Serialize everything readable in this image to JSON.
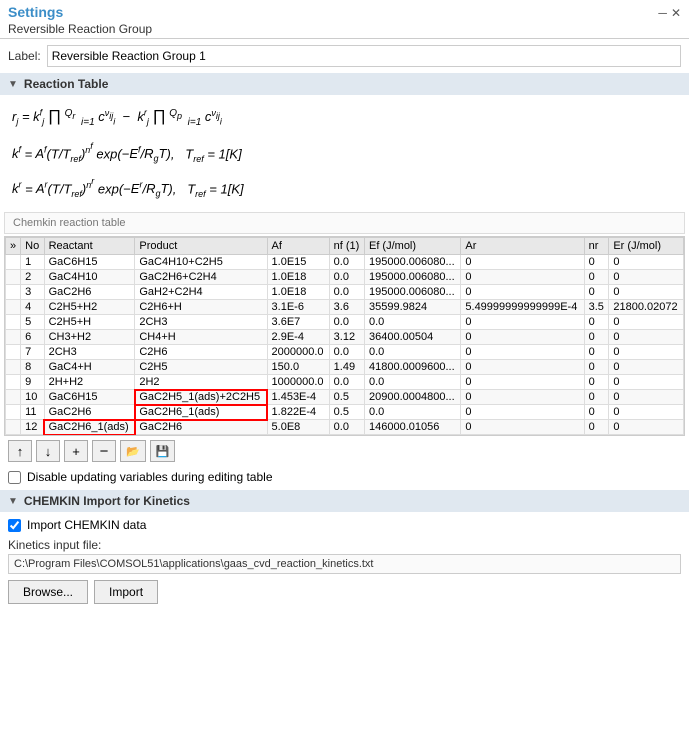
{
  "header": {
    "title": "Settings",
    "subtitle": "Reversible Reaction Group",
    "minimize_icon": "─",
    "close_icon": "✕"
  },
  "label_row": {
    "label": "Label:",
    "value": "Reversible Reaction Group 1"
  },
  "reaction_table_section": {
    "title": "Reaction Table",
    "formula1": "rⱼ = kʲ_f ∏ cᵢ^νᵢⱼ i=1..Qr  − kʲ_r ∏ cᵢ^νᵢⱼ i=1..Qp",
    "formula2": "kᶠ = Aᶠ(T/T_ref)^nf exp(−Eᶠ/RgT),  T_ref = 1[K]",
    "formula3": "kʳ = Aʳ(T/T_ref)^nr exp(−Eʳ/RgT),  T_ref = 1[K]",
    "chemkin_label": "Chemkin reaction table",
    "columns": [
      "",
      "No",
      "Reactant",
      "Product",
      "Af",
      "nf (1)",
      "Ef (J/mol)",
      "Ar",
      "nr",
      "Er (J/mol)"
    ],
    "rows": [
      {
        "no": "1",
        "reactant": "GaC6H15",
        "product": "GaC4H10+C2H5",
        "af": "1.0E15",
        "nf": "0.0",
        "ef": "195000.006080...",
        "ar": "0",
        "nr": "0",
        "er": "0",
        "highlight": false
      },
      {
        "no": "2",
        "reactant": "GaC4H10",
        "product": "GaC2H6+C2H4",
        "af": "1.0E18",
        "nf": "0.0",
        "ef": "195000.006080...",
        "ar": "0",
        "nr": "0",
        "er": "0",
        "highlight": false
      },
      {
        "no": "3",
        "reactant": "GaC2H6",
        "product": "GaH2+C2H4",
        "af": "1.0E18",
        "nf": "0.0",
        "ef": "195000.006080...",
        "ar": "0",
        "nr": "0",
        "er": "0",
        "highlight": false
      },
      {
        "no": "4",
        "reactant": "C2H5+H2",
        "product": "C2H6+H",
        "af": "3.1E-6",
        "nf": "3.6",
        "ef": "35599.9824",
        "ar": "5.49999999999999E-4",
        "nr": "3.5",
        "er": "21800.02072",
        "highlight": false
      },
      {
        "no": "5",
        "reactant": "C2H5+H",
        "product": "2CH3",
        "af": "3.6E7",
        "nf": "0.0",
        "ef": "0.0",
        "ar": "0",
        "nr": "0",
        "er": "0",
        "highlight": false
      },
      {
        "no": "6",
        "reactant": "CH3+H2",
        "product": "CH4+H",
        "af": "2.9E-4",
        "nf": "3.12",
        "ef": "36400.00504",
        "ar": "0",
        "nr": "0",
        "er": "0",
        "highlight": false
      },
      {
        "no": "7",
        "reactant": "2CH3",
        "product": "C2H6",
        "af": "2000000.0",
        "nf": "0.0",
        "ef": "0.0",
        "ar": "0",
        "nr": "0",
        "er": "0",
        "highlight": false
      },
      {
        "no": "8",
        "reactant": "GaC4+H",
        "product": "C2H5",
        "af": "150.0",
        "nf": "1.49",
        "ef": "41800.0009600...",
        "ar": "0",
        "nr": "0",
        "er": "0",
        "highlight": false
      },
      {
        "no": "9",
        "reactant": "2H+H2",
        "product": "2H2",
        "af": "1000000.0",
        "nf": "0.0",
        "ef": "0.0",
        "ar": "0",
        "nr": "0",
        "er": "0",
        "highlight": false
      },
      {
        "no": "10",
        "reactant": "GaC6H15",
        "product": "GaC2H5_1(ads)+2C2H5",
        "af": "1.453E-4",
        "nf": "0.5",
        "ef": "20900.0004800...",
        "ar": "0",
        "nr": "0",
        "er": "0",
        "highlight_product": true
      },
      {
        "no": "11",
        "reactant": "GaC2H6",
        "product": "GaC2H6_1(ads)",
        "af": "1.822E-4",
        "nf": "0.5",
        "ef": "0.0",
        "ar": "0",
        "nr": "0",
        "er": "0",
        "highlight_product": true
      },
      {
        "no": "12",
        "reactant": "GaC2H6_1(ads)",
        "product": "GaC2H6",
        "af": "5.0E8",
        "nf": "0.0",
        "ef": "146000.01056",
        "ar": "0",
        "nr": "0",
        "er": "0",
        "highlight_reactant": true
      }
    ],
    "toolbar_buttons": [
      "↑",
      "↓",
      "+",
      "−",
      "📂",
      "💾"
    ],
    "checkbox_label": "Disable updating variables during editing table",
    "checkbox_checked": false
  },
  "chemkin_section": {
    "title": "CHEMKIN Import for Kinetics",
    "import_label": "Import CHEMKIN data",
    "import_checked": true,
    "file_label": "Kinetics input file:",
    "file_path": "C:\\Program Files\\COMSOL51\\applications\\gaas_cvd_reaction_kinetics.txt",
    "browse_label": "Browse...",
    "import_button_label": "Import"
  }
}
